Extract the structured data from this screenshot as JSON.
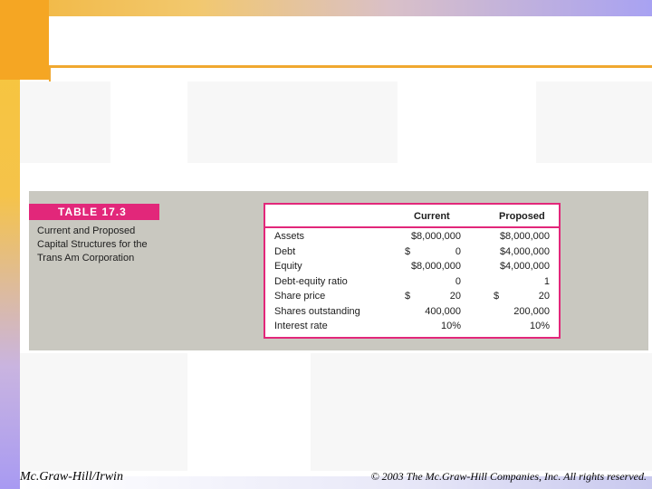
{
  "footer": {
    "left": "Mc.Graw-Hill/Irwin",
    "right": "© 2003 The Mc.Graw-Hill Companies, Inc. All rights reserved."
  },
  "table": {
    "badge": "TABLE 17.3",
    "caption": "Current and Proposed Capital Structures for the Trans Am Corporation",
    "columns": [
      "Current",
      "Proposed"
    ],
    "rows": [
      {
        "label": "Assets",
        "current_sym": "",
        "current": "$8,000,000",
        "proposed_sym": "",
        "proposed": "$8,000,000"
      },
      {
        "label": "Debt",
        "current_sym": "$",
        "current": "0",
        "proposed_sym": "",
        "proposed": "$4,000,000"
      },
      {
        "label": "Equity",
        "current_sym": "",
        "current": "$8,000,000",
        "proposed_sym": "",
        "proposed": "$4,000,000"
      },
      {
        "label": "Debt-equity ratio",
        "current_sym": "",
        "current": "0",
        "proposed_sym": "",
        "proposed": "1"
      },
      {
        "label": "Share price",
        "current_sym": "$",
        "current": "20",
        "proposed_sym": "$",
        "proposed": "20"
      },
      {
        "label": "Shares outstanding",
        "current_sym": "",
        "current": "400,000",
        "proposed_sym": "",
        "proposed": "200,000"
      },
      {
        "label": "Interest rate",
        "current_sym": "",
        "current": "10%",
        "proposed_sym": "",
        "proposed": "10%"
      }
    ]
  },
  "colors": {
    "accent": "#e2277a",
    "panel": "#c9c8c0",
    "gold": "#f0a830"
  }
}
